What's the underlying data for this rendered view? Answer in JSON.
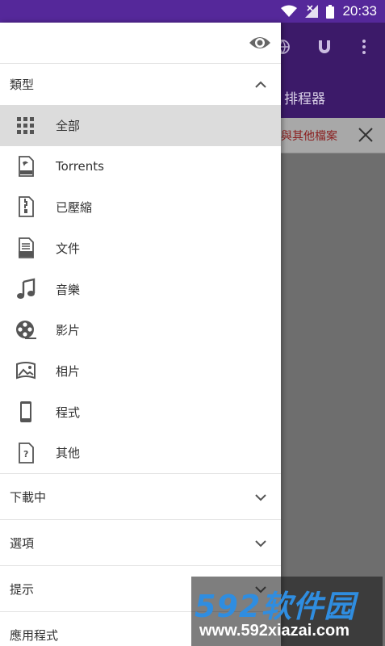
{
  "status_bar": {
    "time": "20:33",
    "icons": [
      "wifi-icon",
      "signal-icon",
      "battery-icon"
    ]
  },
  "background_app": {
    "toolbar_icons": [
      "globe-icon",
      "magnet-icon",
      "more-vert-icon"
    ],
    "title_fragment": "排程器",
    "banner_text": "與其他檔案",
    "accent_color": "#55289a"
  },
  "drawer": {
    "header_icon": "eye-icon",
    "categories_section": {
      "title": "類型",
      "expanded": true,
      "items": [
        {
          "label": "全部",
          "icon": "grid-icon",
          "selected": true
        },
        {
          "label": "Torrents",
          "icon": "torrent-file-icon",
          "selected": false
        },
        {
          "label": "已壓縮",
          "icon": "zip-file-icon",
          "selected": false
        },
        {
          "label": "文件",
          "icon": "doc-file-icon",
          "selected": false
        },
        {
          "label": "音樂",
          "icon": "music-note-icon",
          "selected": false
        },
        {
          "label": "影片",
          "icon": "film-reel-icon",
          "selected": false
        },
        {
          "label": "相片",
          "icon": "photo-icon",
          "selected": false
        },
        {
          "label": "程式",
          "icon": "phone-icon",
          "selected": false
        },
        {
          "label": "其他",
          "icon": "unknown-file-icon",
          "selected": false
        }
      ]
    },
    "sections": [
      {
        "title": "下載中",
        "expanded": false
      },
      {
        "title": "選項",
        "expanded": false
      },
      {
        "title": "提示",
        "expanded": false
      },
      {
        "title": "應用程式",
        "expanded": false
      }
    ]
  },
  "watermark": {
    "logo": "592软件园",
    "url": "www.592xiazai.com"
  }
}
